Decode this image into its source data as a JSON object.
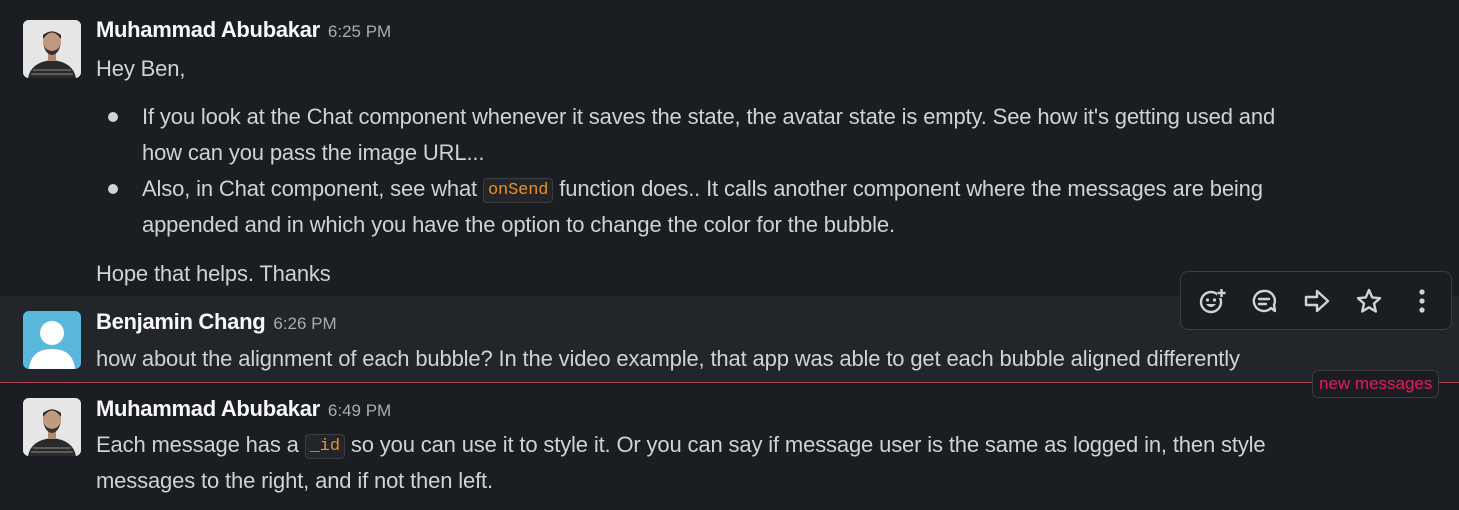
{
  "messages": [
    {
      "author": "Muhammad Abubakar",
      "time": "6:25 PM",
      "greeting": "Hey Ben,",
      "bullets": [
        {
          "line1": "If you look at the Chat component whenever it saves the state, the avatar state is empty. See how it's getting used and",
          "line2": "how can you pass the image URL..."
        },
        {
          "line1_before": "Also, in Chat component, see what",
          "code": "onSend",
          "line1_after": "function does.. It calls another component where the messages are being",
          "line2": "appended and in which you have the option to change the color for the bubble."
        }
      ],
      "closing": "Hope that helps. Thanks"
    },
    {
      "author": "Benjamin Chang",
      "time": "6:26 PM",
      "text": "how about the alignment of each bubble? In the video example, that app was able to get each bubble aligned differently"
    },
    {
      "author": "Muhammad Abubakar",
      "time": "6:49 PM",
      "line1_before": "Each message has a",
      "code": "_id",
      "line1_after": "so you can use it to style it. Or you can say if message user is the same as logged in, then style",
      "line2": "messages to the right, and if not then left."
    }
  ],
  "toolbar": {
    "icons": [
      "add-reaction-icon",
      "reply-thread-icon",
      "share-message-icon",
      "save-star-icon",
      "more-actions-icon"
    ]
  },
  "new_messages_label": "new messages",
  "colors": {
    "background": "#1a1d21",
    "hover_background": "#222529",
    "code_text": "#e8912d",
    "new_messages": "#e01e5a",
    "avatar_default": "#5ab8dc"
  }
}
